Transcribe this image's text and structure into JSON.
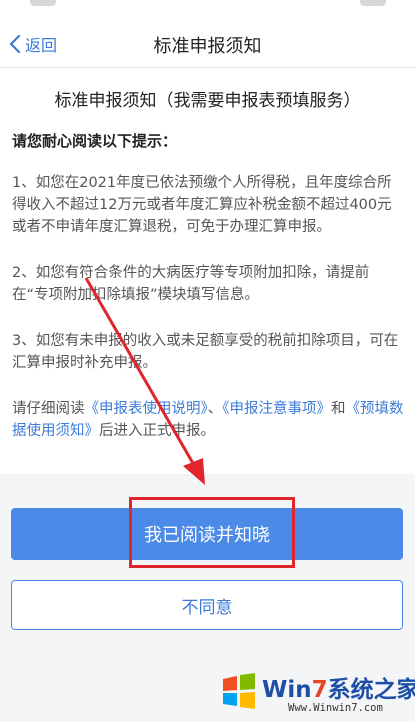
{
  "nav": {
    "back_label": "返回",
    "title": "标准申报须知"
  },
  "notice": {
    "heading": "标准申报须知（我需要申报表预填服务）",
    "subheading": "请您耐心阅读以下提示：",
    "item1": "1、如您在2021年度已依法预缴个人所得税，且年度综合所得收入不超过12万元或者年度汇算应补税金额不超过400元或者不申请年度汇算退税，可免于办理汇算申报。",
    "item2": "2、如您有符合条件的大病医疗等专项附加扣除，请提前在“专项附加扣除填报”模块填写信息。",
    "item3": "3、如您有未申报的收入或未足额享受的税前扣除项目，可在汇算申报时补充申报。",
    "read_prefix": "请仔细阅读",
    "link1": "《申报表使用说明》",
    "separator": "、",
    "link2": "《申报注意事项》",
    "and": "和",
    "link3": "《预填数据使用须知》",
    "read_suffix": "后进入正式申报。"
  },
  "buttons": {
    "agree": "我已阅读并知晓",
    "disagree": "不同意"
  },
  "watermark": {
    "brand_a": "Win",
    "brand_seven": "7",
    "brand_b": "系统之家",
    "url": "Www.Winwin7.com"
  },
  "colors": {
    "accent": "#4b8ae6",
    "link": "#3b7bd8",
    "annotation_red": "#e0262a"
  }
}
